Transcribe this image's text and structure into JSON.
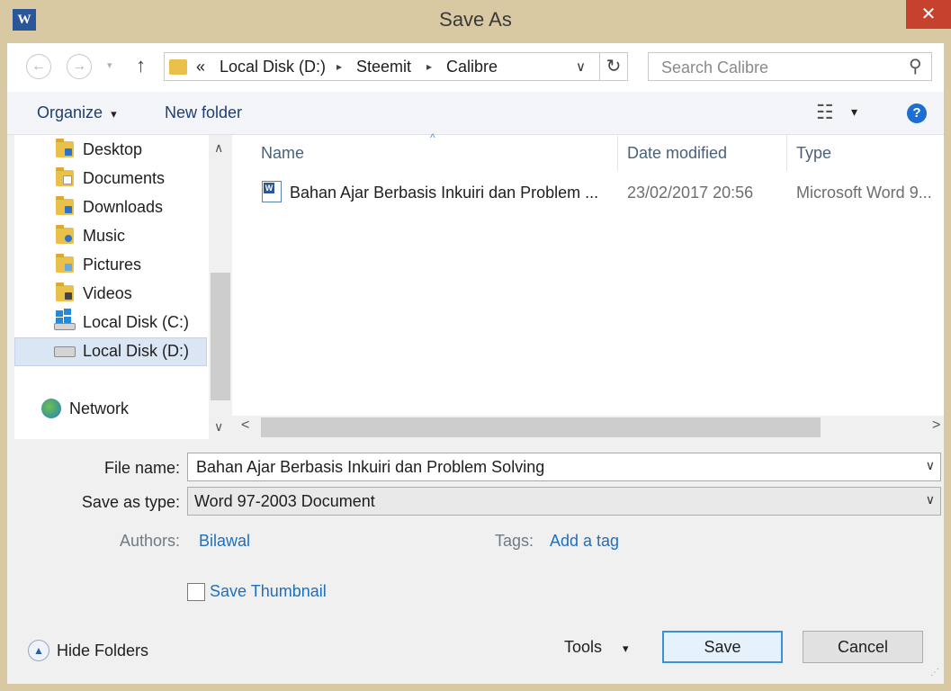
{
  "window": {
    "title": "Save As",
    "app_icon_letter": "W",
    "close_glyph": "✕"
  },
  "navigation": {
    "back_glyph": "←",
    "forward_glyph": "→",
    "recent_glyph": "▾",
    "up_glyph": "↑",
    "breadcrumb_overflow": "«",
    "breadcrumb": [
      "Local Disk (D:)",
      "Steemit",
      "Calibre"
    ],
    "separator_glyph": "▸",
    "dropdown_glyph": "∨",
    "refresh_glyph": "↻",
    "search_placeholder": "Search Calibre",
    "search_glyph": "⚲"
  },
  "toolbar": {
    "organize_label": "Organize",
    "organize_caret": "▾",
    "new_folder_label": "New folder",
    "view_glyph": "☷",
    "view_caret": "▾",
    "help_glyph": "?"
  },
  "sidebar": {
    "items": [
      {
        "label": "Desktop",
        "icon": "desktop-icon"
      },
      {
        "label": "Documents",
        "icon": "documents-icon"
      },
      {
        "label": "Downloads",
        "icon": "downloads-icon"
      },
      {
        "label": "Music",
        "icon": "music-icon"
      },
      {
        "label": "Pictures",
        "icon": "pictures-icon"
      },
      {
        "label": "Videos",
        "icon": "videos-icon"
      },
      {
        "label": "Local Disk (C:)",
        "icon": "windows-drive-icon"
      },
      {
        "label": "Local Disk (D:)",
        "icon": "drive-icon",
        "selected": true
      }
    ],
    "network_label": "Network",
    "scroll_up_glyph": "∧",
    "scroll_down_glyph": "∨"
  },
  "file_list": {
    "columns": [
      "Name",
      "Date modified",
      "Type"
    ],
    "sort_glyph": "^",
    "rows": [
      {
        "name": "Bahan Ajar Berbasis Inkuiri dan Problem ...",
        "date": "23/02/2017 20:56",
        "type": "Microsoft Word 9..."
      }
    ],
    "scroll_left_glyph": "<",
    "scroll_right_glyph": ">"
  },
  "form": {
    "file_name_label": "File name:",
    "file_name_value": "Bahan Ajar Berbasis Inkuiri dan Problem Solving",
    "save_type_label": "Save as type:",
    "save_type_value": "Word 97-2003 Document",
    "combo_glyph": "∨",
    "authors_label": "Authors:",
    "authors_value": "Bilawal",
    "tags_label": "Tags:",
    "tags_value": "Add a tag",
    "thumbnail_label": "Save Thumbnail",
    "thumbnail_checked": false
  },
  "footer": {
    "hide_folders_label": "Hide Folders",
    "hide_folders_glyph": "▲",
    "tools_label": "Tools",
    "tools_caret": "▾",
    "save_label": "Save",
    "cancel_label": "Cancel",
    "grip_glyph": "⋰"
  },
  "colors": {
    "title_bar": "#d9c9a3",
    "close_button": "#c7412f",
    "link": "#1f6fbf",
    "selection": "#dbe6f5",
    "primary_border": "#3c8fd9"
  }
}
